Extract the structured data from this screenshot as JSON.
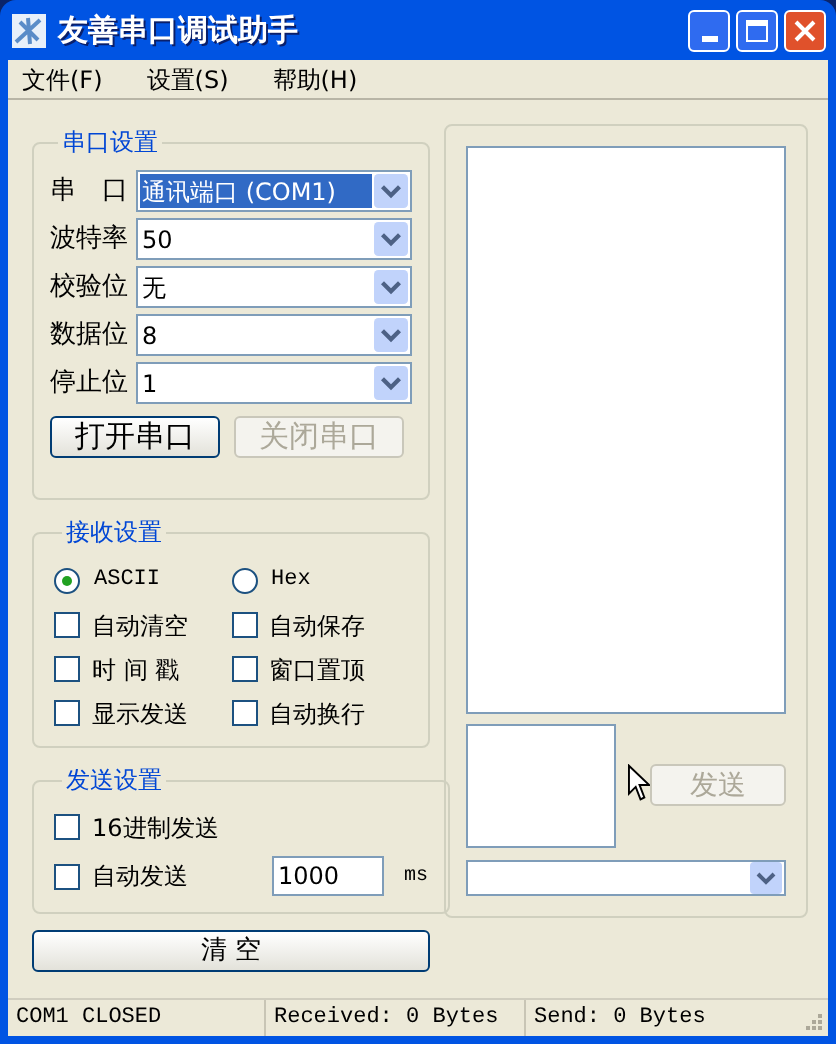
{
  "window": {
    "title": "友善串口调试助手"
  },
  "menu": [
    {
      "label": "文件(F)"
    },
    {
      "label": "设置(S)"
    },
    {
      "label": "帮助(H)"
    }
  ],
  "serial_settings": {
    "title": "串口设置",
    "fields": [
      {
        "label": "串　口",
        "value": "通讯端口 (COM1)",
        "selected": true
      },
      {
        "label": "波特率",
        "value": "50",
        "selected": false
      },
      {
        "label": "校验位",
        "value": "无",
        "selected": false
      },
      {
        "label": "数据位",
        "value": "8",
        "selected": false
      },
      {
        "label": "停止位",
        "value": "1",
        "selected": false
      }
    ],
    "buttons": [
      {
        "label": "打开串口",
        "disabled": false
      },
      {
        "label": "关闭串口",
        "disabled": true
      }
    ]
  },
  "receive_settings": {
    "title": "接收设置",
    "formats": [
      {
        "label": "ASCII",
        "selected": true
      },
      {
        "label": "Hex",
        "selected": false
      }
    ],
    "options": [
      {
        "label": "自动清空",
        "checked": false
      },
      {
        "label": "自动保存",
        "checked": false
      },
      {
        "label": "时 间 戳",
        "checked": false
      },
      {
        "label": "窗口置顶",
        "checked": false
      },
      {
        "label": "显示发送",
        "checked": false
      },
      {
        "label": "自动换行",
        "checked": false
      }
    ]
  },
  "send_settings": {
    "title": "发送设置",
    "hex_send": {
      "label": "16进制发送",
      "checked": false
    },
    "auto_send": {
      "label": "自动发送",
      "checked": false,
      "interval": "1000",
      "unit": "ms"
    }
  },
  "clear_button": {
    "label": "清 空"
  },
  "send_button": {
    "label": "发送",
    "disabled": true
  },
  "status_bar": [
    "COM1 CLOSED",
    "Received: 0 Bytes",
    "Send: 0 Bytes"
  ]
}
